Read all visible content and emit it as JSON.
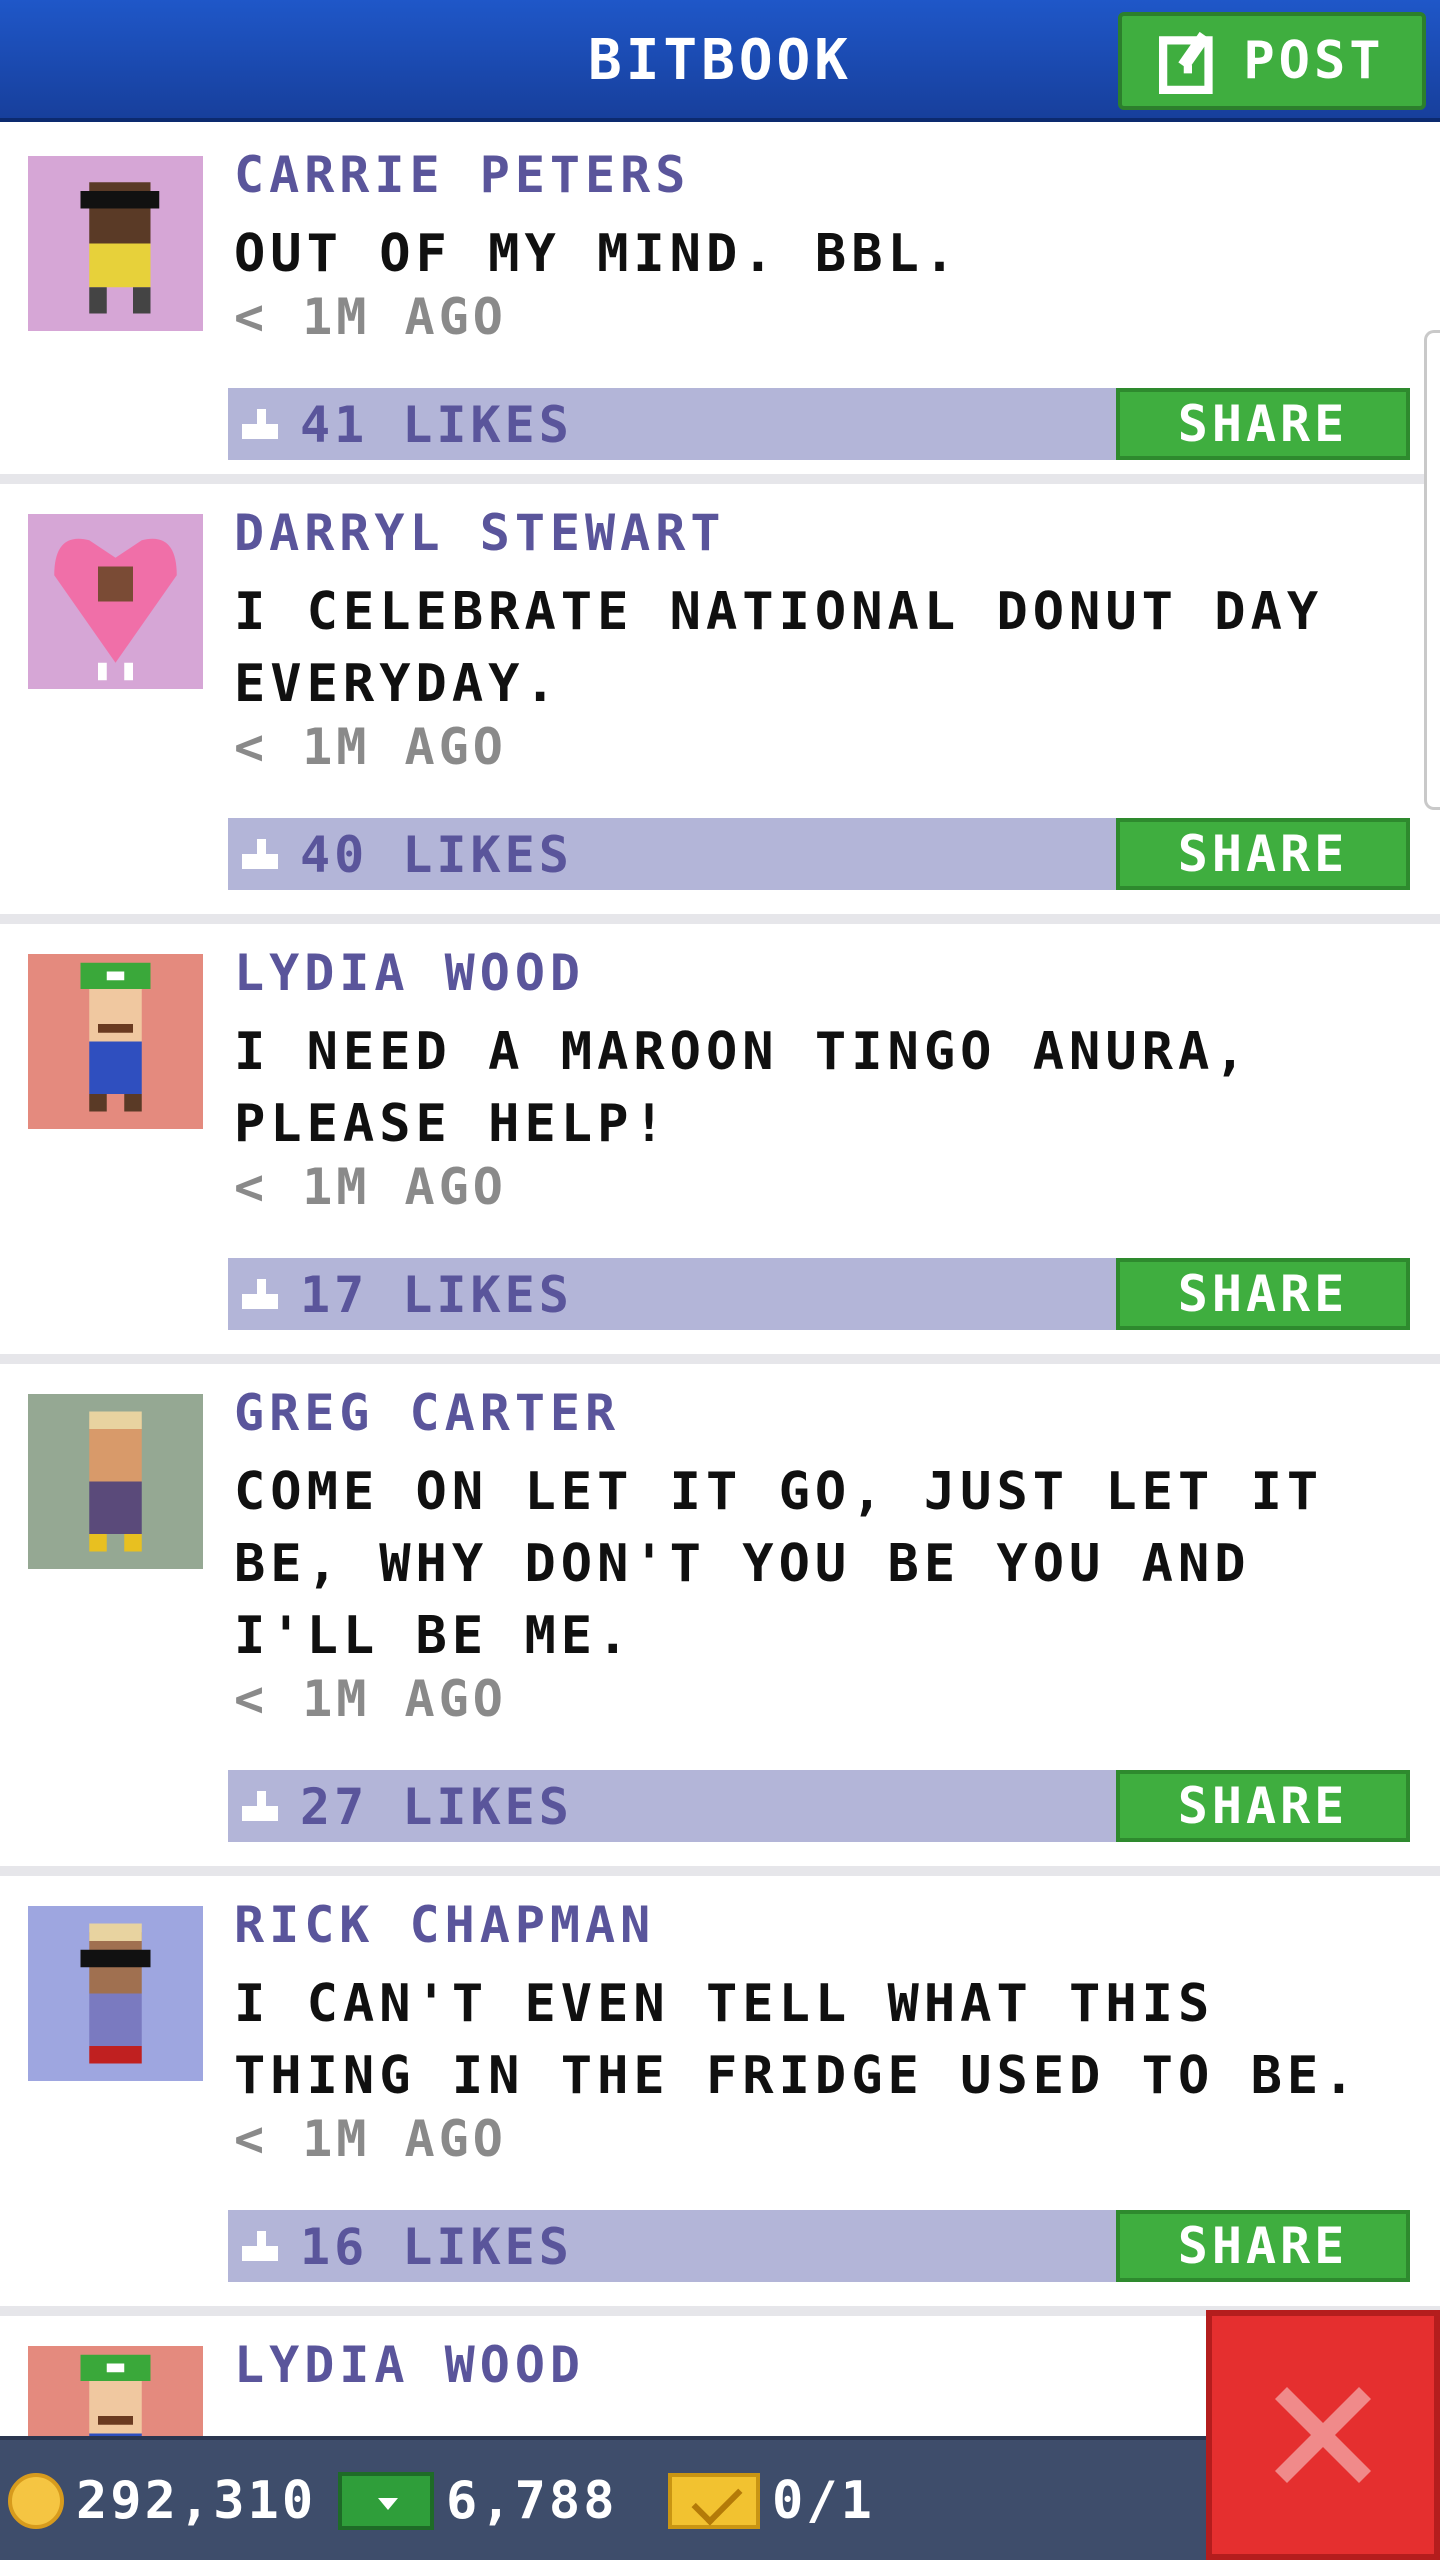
{
  "header": {
    "title": "BITBOOK",
    "post_label": "POST"
  },
  "posts": [
    {
      "name": "CARRIE PETERS",
      "text": "OUT OF MY MIND. BBL.",
      "time": "< 1M AGO",
      "likes": "41 LIKES",
      "share": "SHARE",
      "bg": "#d6a6d6"
    },
    {
      "name": "DARRYL STEWART",
      "text": "I CELEBRATE NATIONAL DONUT DAY EVERYDAY.",
      "time": "< 1M AGO",
      "likes": "40 LIKES",
      "share": "SHARE",
      "bg": "#d6a6d6"
    },
    {
      "name": "LYDIA WOOD",
      "text": "I NEED A MAROON TINGO ANURA, PLEASE HELP!",
      "time": "< 1M AGO",
      "likes": "17 LIKES",
      "share": "SHARE",
      "bg": "#e48a7e"
    },
    {
      "name": "GREG CARTER",
      "text": "COME ON LET IT GO, JUST LET IT BE, WHY DON'T YOU BE YOU AND I'LL BE ME.",
      "time": "< 1M AGO",
      "likes": "27 LIKES",
      "share": "SHARE",
      "bg": "#95a893"
    },
    {
      "name": "RICK CHAPMAN",
      "text": "I CAN'T EVEN TELL WHAT THIS THING IN THE FRIDGE USED TO BE.",
      "time": "< 1M AGO",
      "likes": "16 LIKES",
      "share": "SHARE",
      "bg": "#9ea6e0"
    },
    {
      "name": "LYDIA WOOD",
      "text": "",
      "time": "",
      "likes": "",
      "share": "",
      "bg": "#e48a7e"
    }
  ],
  "bottom_bar": {
    "coins": "292,310",
    "bux": "6,788",
    "tickets": "0/1"
  },
  "icons": {
    "post": "edit-icon",
    "like": "thumbs-up-icon",
    "coins": "coin-icon",
    "bux": "bitbux-icon",
    "tickets": "ticket-icon",
    "close": "close-icon"
  },
  "colors": {
    "header": "#1f57c8",
    "accent_green": "#3fae3f",
    "likes_bar": "#b3b5d8",
    "name": "#5a559b",
    "close": "#e52f2f"
  }
}
